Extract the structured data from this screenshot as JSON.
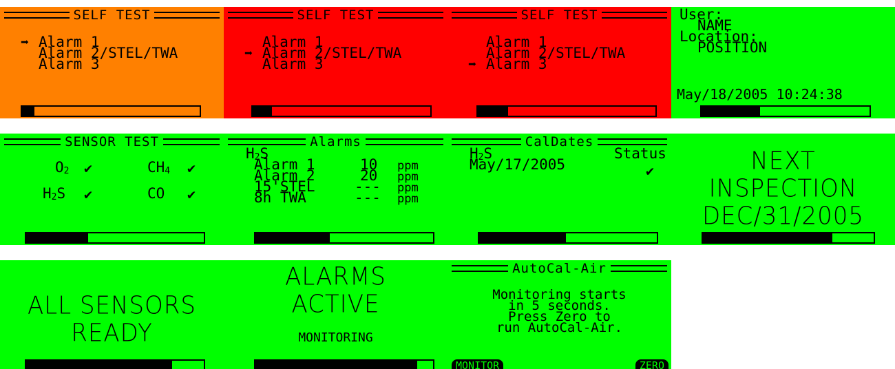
{
  "row1": {
    "self_test_orange": {
      "title": "SELF TEST",
      "items": [
        "Alarm 1",
        "Alarm 2/STEL/TWA",
        "Alarm 3"
      ],
      "selected_index": 0,
      "progress": 0.07,
      "bg": "#ff8000"
    },
    "self_test_red_1": {
      "title": "SELF TEST",
      "items": [
        "Alarm 1",
        "Alarm 2/STEL/TWA",
        "Alarm 3"
      ],
      "selected_index": 1,
      "progress": 0.11,
      "bg": "#ff0000"
    },
    "self_test_red_2": {
      "title": "SELF TEST",
      "items": [
        "Alarm 1",
        "Alarm 2/STEL/TWA",
        "Alarm 3"
      ],
      "selected_index": 2,
      "progress": 0.17,
      "bg": "#ff0000"
    },
    "user_info": {
      "user_label": "User:",
      "user_value": "NAME",
      "location_label": "Location:",
      "location_value": "POSITION",
      "datetime": "May/18/2005 10:24:38",
      "progress": 0.35
    }
  },
  "row2": {
    "sensor_test": {
      "title": "SENSOR TEST",
      "sensors": [
        {
          "base": "O",
          "sub": "2",
          "check": "✔"
        },
        {
          "base": "CH",
          "sub": "4",
          "check": "✔"
        },
        {
          "base": "H",
          "sub": "2",
          "tail": "S",
          "check": "✔"
        },
        {
          "base": "CO",
          "sub": "",
          "check": "✔"
        }
      ],
      "progress": 0.35
    },
    "alarms": {
      "title": "Alarms",
      "gas": {
        "base": "H",
        "sub": "2",
        "tail": "S"
      },
      "rows": [
        {
          "label": "Alarm 1",
          "value": "10",
          "unit": "ppm"
        },
        {
          "label": "Alarm 2",
          "value": "20",
          "unit": "ppm"
        },
        {
          "label": "15'STEL",
          "value": "---",
          "unit": "ppm"
        },
        {
          "label": "8h TWA",
          "value": "---",
          "unit": "ppm"
        }
      ],
      "progress": 0.42
    },
    "cal_dates": {
      "title": "CalDates",
      "gas": {
        "base": "H",
        "sub": "2",
        "tail": "S"
      },
      "date": "May/17/2005",
      "status_label": "Status",
      "status_check": "✔",
      "progress": 0.49
    },
    "next_inspection": {
      "line1": "NEXT",
      "line2": "INSPECTION",
      "line3": "DEC/31/2005",
      "progress": 0.76
    }
  },
  "row3": {
    "all_sensors": {
      "line1": "ALL SENSORS",
      "line2": "READY",
      "progress": 0.82
    },
    "alarms_active": {
      "line1": "ALARMS",
      "line2": "ACTIVE",
      "line3": "MONITORING",
      "progress": 0.91
    },
    "autocal": {
      "title": "AutoCal-Air",
      "lines": [
        "Monitoring starts",
        "in 5 seconds.",
        "Press Zero to",
        "run AutoCal-Air."
      ],
      "left_key": "MONITOR",
      "right_key": "ZERO"
    }
  },
  "colors": {
    "green": "#00ff00",
    "orange": "#ff8000",
    "red": "#ff0000",
    "ink": "#000000"
  }
}
